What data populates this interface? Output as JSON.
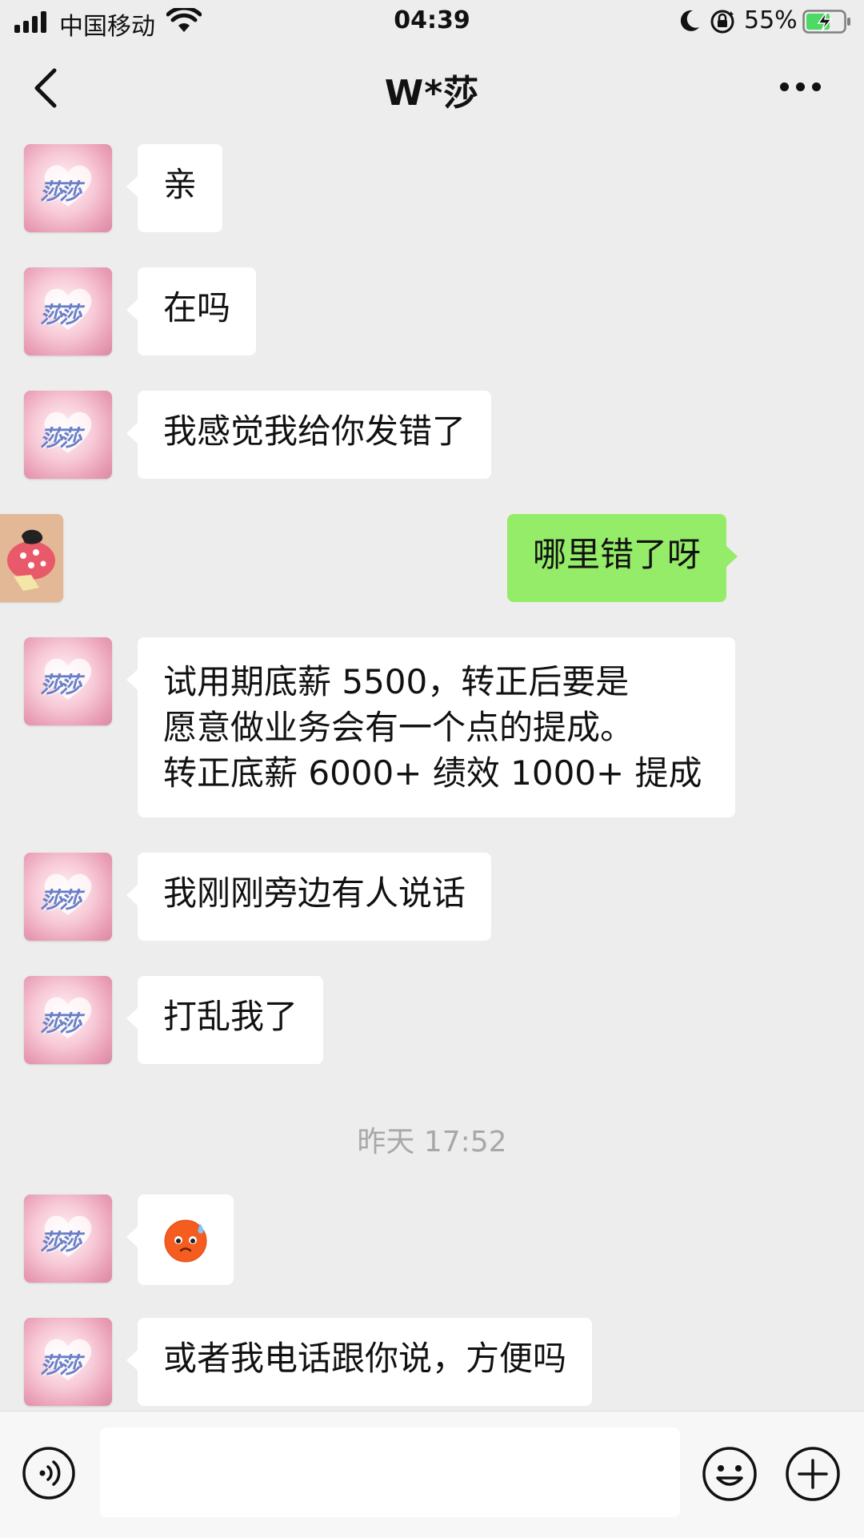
{
  "status_bar": {
    "carrier": "中国移动",
    "time": "04:39",
    "battery": "55%"
  },
  "nav": {
    "title": "W*莎"
  },
  "avatars": {
    "contact_text": "莎莎"
  },
  "messages": [
    {
      "side": "in",
      "text": "亲"
    },
    {
      "side": "in",
      "text": "在吗"
    },
    {
      "side": "in",
      "text": "我感觉我给你发错了"
    },
    {
      "side": "out",
      "text": "哪里错了呀"
    },
    {
      "side": "in",
      "lines": [
        "试用期底薪 5500，转正后要是",
        "愿意做业务会有一个点的提成。",
        "转正底薪 6000+ 绩效 1000+ 提成"
      ]
    },
    {
      "side": "in",
      "text": "我刚刚旁边有人说话"
    },
    {
      "side": "in",
      "text": "打乱我了"
    },
    {
      "side": "in",
      "emoji": "cold-sweat-face-emoji"
    },
    {
      "side": "in",
      "text": "或者我电话跟你说，方便吗"
    }
  ],
  "time_separator": "昨天 17:52",
  "colors": {
    "background": "#ededed",
    "incoming_bubble": "#ffffff",
    "outgoing_bubble": "#95ec69",
    "timestamp": "#a8a8a8"
  },
  "icons": [
    "back-chevron-icon",
    "more-dots-icon",
    "voice-icon",
    "emoji-icon",
    "plus-icon"
  ]
}
